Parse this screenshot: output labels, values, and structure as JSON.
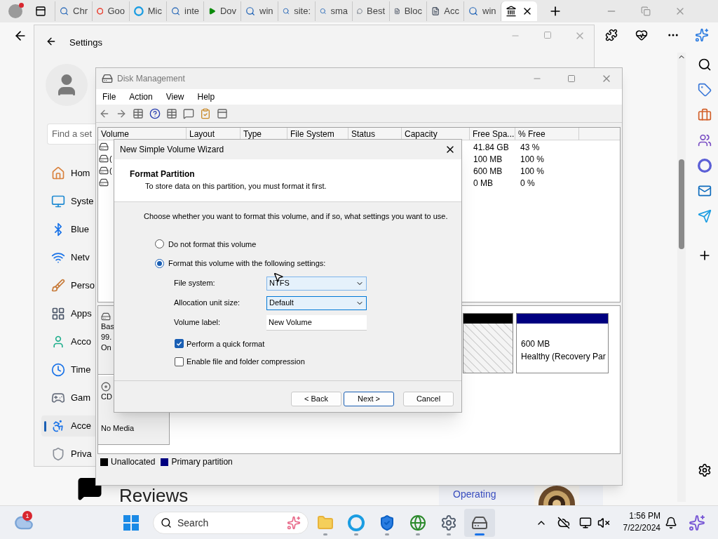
{
  "browser": {
    "tabs": [
      {
        "kind": "search",
        "label": "Chr",
        "selected": false
      },
      {
        "kind": "google",
        "label": "Goo",
        "selected": false
      },
      {
        "kind": "edge",
        "label": "Mic",
        "selected": false
      },
      {
        "kind": "search",
        "label": "inte",
        "selected": false
      },
      {
        "kind": "play",
        "label": "Dov",
        "selected": false
      },
      {
        "kind": "search",
        "label": "win",
        "selected": false
      },
      {
        "kind": "search",
        "label": "site:",
        "selected": false
      },
      {
        "kind": "search",
        "label": "sma",
        "selected": false
      },
      {
        "kind": "chat",
        "label": "Best",
        "selected": false
      },
      {
        "kind": "doc",
        "label": "Bloc",
        "selected": false
      },
      {
        "kind": "doc",
        "label": "Acc",
        "selected": false
      },
      {
        "kind": "search",
        "label": "win",
        "selected": false
      },
      {
        "kind": "museum",
        "selected": true
      }
    ],
    "page": {
      "heading": "Reviews",
      "link": "Operating"
    }
  },
  "settings": {
    "title": "Settings",
    "search_placeholder": "Find a set",
    "nav": [
      {
        "kind": "home",
        "label": "Hom",
        "selected": false
      },
      {
        "kind": "system",
        "label": "Syste",
        "selected": false
      },
      {
        "kind": "bluetooth",
        "label": "Blue",
        "selected": false
      },
      {
        "kind": "network",
        "label": "Netv",
        "selected": false
      },
      {
        "kind": "brush",
        "label": "Perso",
        "selected": false
      },
      {
        "kind": "apps",
        "label": "Apps",
        "selected": false
      },
      {
        "kind": "account",
        "label": "Acco",
        "selected": false
      },
      {
        "kind": "time",
        "label": "Time",
        "selected": false
      },
      {
        "kind": "gaming",
        "label": "Gam",
        "selected": false
      },
      {
        "kind": "accessibility",
        "label": "Acce",
        "selected": true
      },
      {
        "kind": "privacy",
        "label": "Priva",
        "selected": false
      }
    ]
  },
  "disk_management": {
    "title": "Disk Management",
    "menu": [
      "File",
      "Action",
      "View",
      "Help"
    ],
    "columns": [
      "Volume",
      "Layout",
      "Type",
      "File System",
      "Status",
      "Capacity",
      "Free Spa...",
      "% Free"
    ],
    "rows": [
      {
        "free": "41.84 GB",
        "pct": "43 %"
      },
      {
        "volume": "(",
        "free": "100 MB",
        "pct": "100 %"
      },
      {
        "volume": "(",
        "free": "600 MB",
        "pct": "100 %"
      },
      {
        "free": "0 MB",
        "pct": "0 %"
      }
    ],
    "disks": [
      {
        "kind": "disk",
        "lines": [
          "Bas",
          "99.",
          "On"
        ]
      },
      {
        "kind": "cdrom",
        "lines": [
          "CD",
          "No Media"
        ]
      }
    ],
    "partitions": [
      {
        "kind": "unallocated"
      },
      {
        "kind": "primary",
        "size": "600 MB",
        "status": "Healthy (Recovery Par"
      }
    ],
    "legend": [
      {
        "label": "Unallocated",
        "color": "#000000"
      },
      {
        "label": "Primary partition",
        "color": "#000080"
      }
    ]
  },
  "wizard": {
    "title": "New Simple Volume Wizard",
    "heading": "Format Partition",
    "subtitle": "To store data on this partition, you must format it first.",
    "prompt": "Choose whether you want to format this volume, and if so, what settings you want to use.",
    "options": [
      {
        "label": "Do not format this volume",
        "selected": false
      },
      {
        "label": "Format this volume with the following settings:",
        "selected": true
      }
    ],
    "fields": [
      {
        "kind": "select",
        "label": "File system:",
        "value": "NTFS",
        "focused": false
      },
      {
        "kind": "select",
        "label": "Allocation unit size:",
        "value": "Default",
        "focused": true
      },
      {
        "kind": "text",
        "label": "Volume label:",
        "value": "New Volume",
        "focused": false
      }
    ],
    "checks": [
      {
        "label": "Perform a quick format",
        "checked": true
      },
      {
        "label": "Enable file and folder compression",
        "checked": false
      }
    ],
    "buttons": [
      {
        "label": "< Back",
        "default": false
      },
      {
        "label": "Next >",
        "default": true
      },
      {
        "label": "Cancel",
        "default": false
      }
    ]
  },
  "taskbar": {
    "weather_badge": "1",
    "search_placeholder": "Search",
    "apps": [
      {
        "kind": "explorer",
        "selected": false
      },
      {
        "kind": "edge",
        "selected": false
      },
      {
        "kind": "defender",
        "selected": false
      },
      {
        "kind": "globe",
        "selected": false
      },
      {
        "kind": "settings",
        "selected": false
      },
      {
        "kind": "diskmgmt",
        "selected": true
      }
    ],
    "time": "1:56 PM",
    "date": "7/22/2024"
  }
}
